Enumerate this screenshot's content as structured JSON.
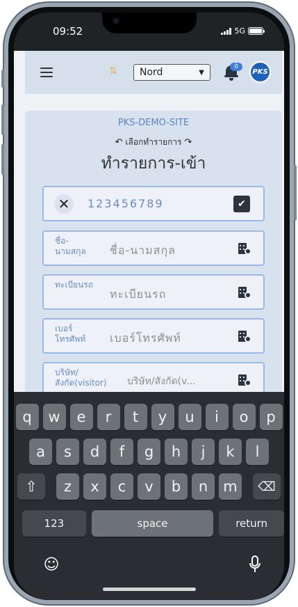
{
  "status": {
    "time": "09:52",
    "network": "5G"
  },
  "header": {
    "site_select_value": "Nord",
    "notification_count": "0",
    "avatar_text": "PKS"
  },
  "main": {
    "site_name": "PKS-DEMO-SITE",
    "choose_text": "เลือกทำรายการ",
    "title": "ทำรายการ-เข้า",
    "code_value": "123456789",
    "fields": [
      {
        "label": "ชื่อ-นามสกุล",
        "placeholder": "ชื่อ-นามสกุล"
      },
      {
        "label": "ทะเบียนรถ",
        "placeholder": "ทะเบียนรถ"
      },
      {
        "label": "เบอร์โทรศัพท์",
        "placeholder": "เบอร์โทรศัพท์"
      },
      {
        "label": "บริษัท/สังกัด(visitor)",
        "placeholder": "บริษัท/สังกัด(v..."
      }
    ]
  },
  "keyboard": {
    "row1": [
      "q",
      "w",
      "e",
      "r",
      "t",
      "y",
      "u",
      "i",
      "o",
      "p"
    ],
    "row2": [
      "a",
      "s",
      "d",
      "f",
      "g",
      "h",
      "j",
      "k",
      "l"
    ],
    "row3": [
      "z",
      "x",
      "c",
      "v",
      "b",
      "n",
      "m"
    ],
    "numbers_label": "123",
    "space_label": "space",
    "return_label": "return"
  }
}
